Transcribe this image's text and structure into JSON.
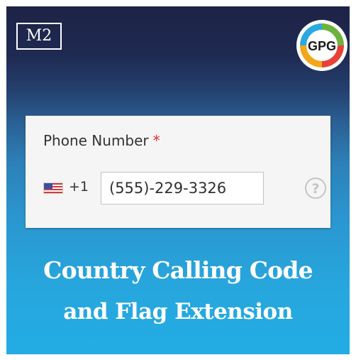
{
  "brand_badge": "M2",
  "logo": {
    "text": "GPG",
    "icon": "gpg-logo-icon",
    "colors": [
      "#f2a71b",
      "#e8403a",
      "#2aa9e0",
      "#6cb33e"
    ]
  },
  "phone_field": {
    "label": "Phone Number",
    "required_marker": "*",
    "flag_icon": "us-flag-icon",
    "dial_code": "+1",
    "value": "(555)-229-3326",
    "help_icon": "question-circle-icon"
  },
  "title": {
    "line1": "Country Calling Code",
    "line2": "and Flag Extension"
  },
  "colors": {
    "background_top": "#1d2346",
    "background_bottom": "#23ace4",
    "required": "#e02b27"
  }
}
